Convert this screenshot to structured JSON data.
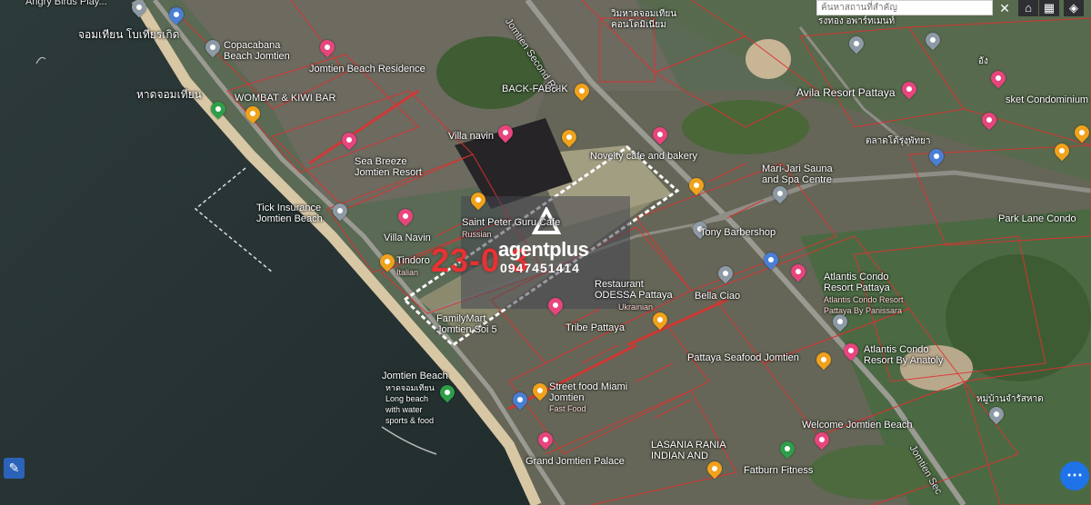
{
  "search": {
    "placeholder": "ค้นหาสถานที่สำคัญ"
  },
  "toolbar": {
    "close_icon": "close-icon",
    "home_icon": "home-icon",
    "grid_icon": "grid-icon",
    "layers_icon": "layers-icon",
    "close_glyph": "✕",
    "home_glyph": "⌂",
    "grid_glyph": "▦",
    "layers_glyph": "◈"
  },
  "watermark": {
    "brand": "agentplus",
    "phone": "0947451414",
    "code": "23-0    3"
  },
  "places": {
    "angry_birds": "Angry Birds Play...",
    "jomtien_thai": "จอมเทียน โบเทียรเกิด",
    "copacabana": "Copacabana\nBeach Jomtien",
    "jomtien_beach_residence": "Jomtien Beach Residence",
    "wombat": "WOMBAT & KIWI BAR",
    "haad_jomtien": "หาดจอมเทียน",
    "sea_breeze": "Sea Breeze\nJomtien Resort",
    "villa_navin_top": "Villa navin",
    "back_fabrik": "BACK-FABRIK",
    "second_rd": "Jomtien Second Rd",
    "tick_insurance": "Tick Insurance\nJomtien Beach",
    "villa_navin": "Villa Navin",
    "tindoro": "Tindoro",
    "tindoro_sub": "Italian",
    "saint_peter": "Saint Peter Guru Cafe",
    "saint_peter_sub": "Russian",
    "novelty": "Novelty cafe and bakery",
    "mari_jari": "Mari-Jari Sauna\nand Spa Centre",
    "tony_barbershop": "Tony Barbershop",
    "restaurant_odessa": "Restaurant\nODESSA Pattaya",
    "odessa_sub": "Ukrainian",
    "bella_ciao": "Bella Ciao",
    "familymart": "FamilyMart\nJomtien Soi 5",
    "tribe": "Tribe Pattaya",
    "atlantis1": "Atlantis Condo\nResort Pattaya",
    "atlantis1_sub": "Atlantis Condo Resort\nPattaya By Panissara",
    "atlantis2": "Atlantis Condo\nResort By Anatoly",
    "pattaya_seafood": "Pattaya Seafood Jomtien",
    "avila": "Avila Resort Pattaya",
    "market_thai": "ตลาดโต้รุ่งพัทยา",
    "sket_condo": "sket Condominium",
    "park_lane": "Park Lane Condo",
    "jomtien_beach_label": "Jomtien Beach",
    "jomtien_beach_sub": "หาดจอมเทียน\nLong beach\nwith water\nsports & food",
    "street_food": "Street food Miami\nJomtien",
    "street_food_sub": "Fast Food",
    "welcome": "Welcome Jomtien Beach",
    "lasania": "LASANIA RANIA\nINDIAN AND",
    "grand_palace": "Grand Jomtien Palace",
    "fatburn": "Fatburn Fitness",
    "jomtien_sec": "Jomtien Sec",
    "thai_village": "หมู่บ้านจำรัสหาด",
    "thai_top": "วิมหาดจอมเทียน\nคอนโดมิเนียม",
    "thai_right": "รงทอง อพาร์ทเมนท์",
    "ang": "อัง"
  },
  "buttons": {
    "tool": "✎",
    "more": "⋯"
  }
}
